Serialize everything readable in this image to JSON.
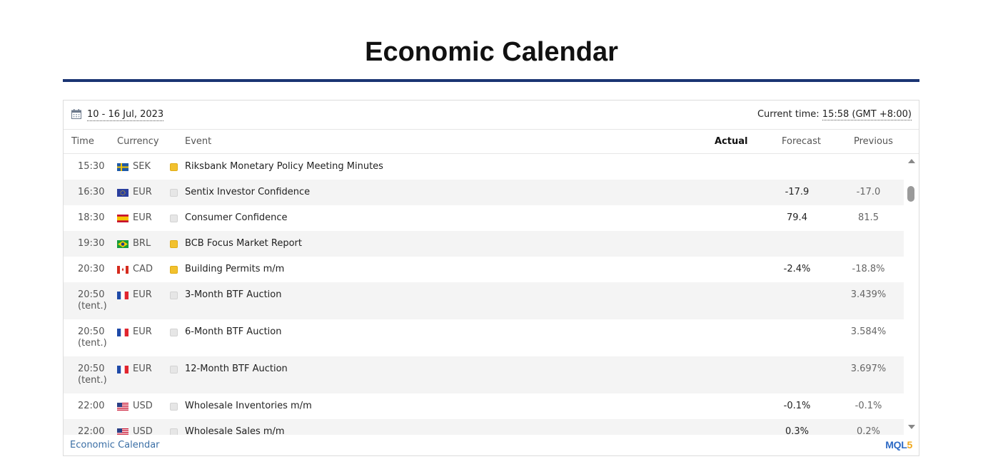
{
  "page": {
    "title": "Economic Calendar"
  },
  "topbar": {
    "date_range": "10 - 16 Jul, 2023",
    "current_time_label": "Current time:",
    "current_time_value": "15:58 (GMT +8:00)"
  },
  "columns": {
    "time": "Time",
    "currency": "Currency",
    "event": "Event",
    "actual": "Actual",
    "forecast": "Forecast",
    "previous": "Previous"
  },
  "events": [
    {
      "time": "15:30",
      "tent": "",
      "flag": "SE",
      "currency": "SEK",
      "importance": "medium",
      "event": "Riksbank Monetary Policy Meeting Minutes",
      "forecast": "",
      "previous": ""
    },
    {
      "time": "16:30",
      "tent": "",
      "flag": "EU",
      "currency": "EUR",
      "importance": "none",
      "event": "Sentix Investor Confidence",
      "forecast": "-17.9",
      "previous": "-17.0"
    },
    {
      "time": "18:30",
      "tent": "",
      "flag": "ES",
      "currency": "EUR",
      "importance": "none",
      "event": "Consumer Confidence",
      "forecast": "79.4",
      "previous": "81.5"
    },
    {
      "time": "19:30",
      "tent": "",
      "flag": "BR",
      "currency": "BRL",
      "importance": "medium",
      "event": "BCB Focus Market Report",
      "forecast": "",
      "previous": ""
    },
    {
      "time": "20:30",
      "tent": "",
      "flag": "CA",
      "currency": "CAD",
      "importance": "medium",
      "event": "Building Permits m/m",
      "forecast": "-2.4%",
      "previous": "-18.8%"
    },
    {
      "time": "20:50",
      "tent": "(tent.)",
      "flag": "FR",
      "currency": "EUR",
      "importance": "none",
      "event": "3-Month BTF Auction",
      "forecast": "",
      "previous": "3.439%"
    },
    {
      "time": "20:50",
      "tent": "(tent.)",
      "flag": "FR",
      "currency": "EUR",
      "importance": "none",
      "event": "6-Month BTF Auction",
      "forecast": "",
      "previous": "3.584%"
    },
    {
      "time": "20:50",
      "tent": "(tent.)",
      "flag": "FR",
      "currency": "EUR",
      "importance": "none",
      "event": "12-Month BTF Auction",
      "forecast": "",
      "previous": "3.697%"
    },
    {
      "time": "22:00",
      "tent": "",
      "flag": "US",
      "currency": "USD",
      "importance": "none",
      "event": "Wholesale Inventories m/m",
      "forecast": "-0.1%",
      "previous": "-0.1%"
    },
    {
      "time": "22:00",
      "tent": "",
      "flag": "US",
      "currency": "USD",
      "importance": "none",
      "event": "Wholesale Sales m/m",
      "forecast": "0.3%",
      "previous": "0.2%"
    }
  ],
  "footer": {
    "link": "Economic Calendar",
    "brand_main": "MQL",
    "brand_num": "5"
  },
  "colors": {
    "title_rule": "#1a3473",
    "importance_medium": "#f2c12e",
    "link": "#3a6ea5"
  }
}
